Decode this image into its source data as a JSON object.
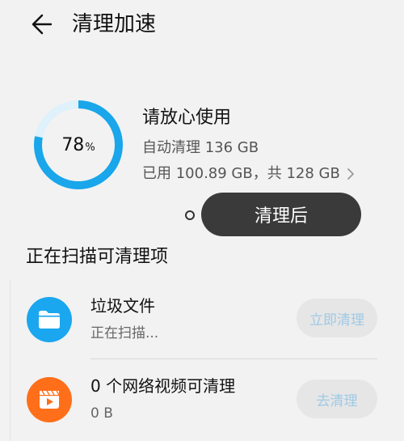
{
  "header": {
    "title": "清理加速"
  },
  "summary": {
    "percent": "78",
    "percent_unit": "%",
    "percent_value": 78,
    "status": "请放心使用",
    "auto_clean": "自动清理 136 GB",
    "storage": "已用 100.89 GB，共 128 GB"
  },
  "after_button": {
    "label": "清理后"
  },
  "section": {
    "title": "正在扫描可清理项"
  },
  "items": [
    {
      "name": "垃圾文件",
      "sub": "正在扫描...",
      "action": "立即清理",
      "icon": "folder-icon",
      "icon_color": "#1aa7ef"
    },
    {
      "name": "0 个网络视频可清理",
      "sub": "0 B",
      "action": "去清理",
      "icon": "video-icon",
      "icon_color": "#ff6f1a"
    }
  ],
  "colors": {
    "ring": "#19a6ea",
    "ring_track": "#dff1fb",
    "button_dark": "#3a3a3a",
    "pill_text": "#9ec9e6"
  }
}
